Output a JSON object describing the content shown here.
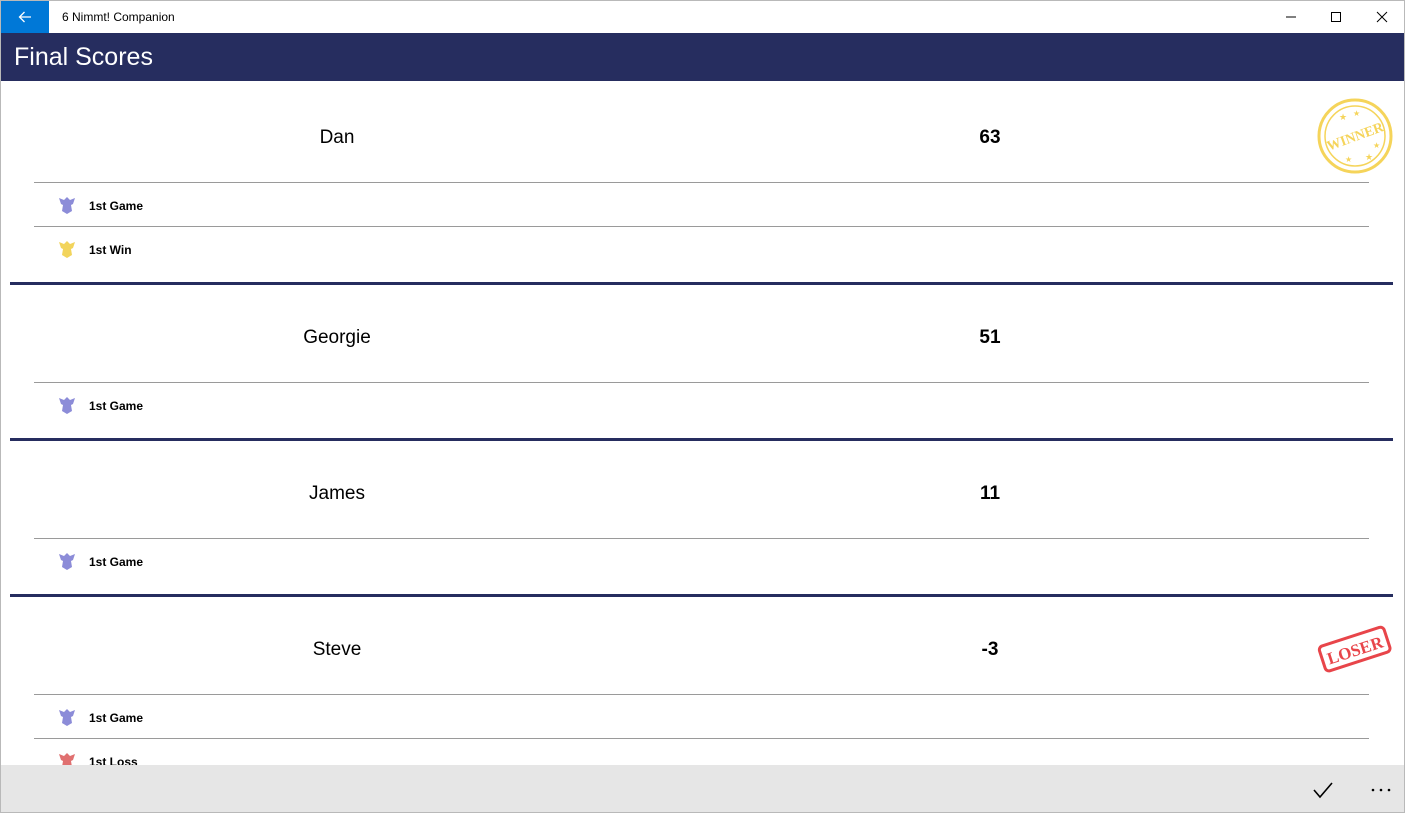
{
  "window": {
    "title": "6 Nimmt! Companion"
  },
  "header": {
    "title": "Final Scores"
  },
  "players": [
    {
      "name": "Dan",
      "score": "63",
      "stamp": "WINNER",
      "achievements": [
        {
          "label": "1st Game",
          "icon": "game-trophy-icon",
          "color": "#8c8cd8"
        },
        {
          "label": "1st Win",
          "icon": "win-trophy-icon",
          "color": "#f2d45c"
        }
      ]
    },
    {
      "name": "Georgie",
      "score": "51",
      "achievements": [
        {
          "label": "1st Game",
          "icon": "game-trophy-icon",
          "color": "#8c8cd8"
        }
      ]
    },
    {
      "name": "James",
      "score": "11",
      "achievements": [
        {
          "label": "1st Game",
          "icon": "game-trophy-icon",
          "color": "#8c8cd8"
        }
      ]
    },
    {
      "name": "Steve",
      "score": "-3",
      "stamp": "LOSER",
      "achievements": [
        {
          "label": "1st Game",
          "icon": "game-trophy-icon",
          "color": "#8c8cd8"
        },
        {
          "label": "1st Loss",
          "icon": "loss-trophy-icon",
          "color": "#e07070"
        }
      ]
    }
  ],
  "commandbar": {
    "accept_icon": "checkmark-icon",
    "more_icon": "more-icon"
  },
  "colors": {
    "accent": "#0078d7",
    "header": "#262d5f",
    "winner_stamp": "#f5d45a",
    "loser_stamp": "#e8454a"
  }
}
